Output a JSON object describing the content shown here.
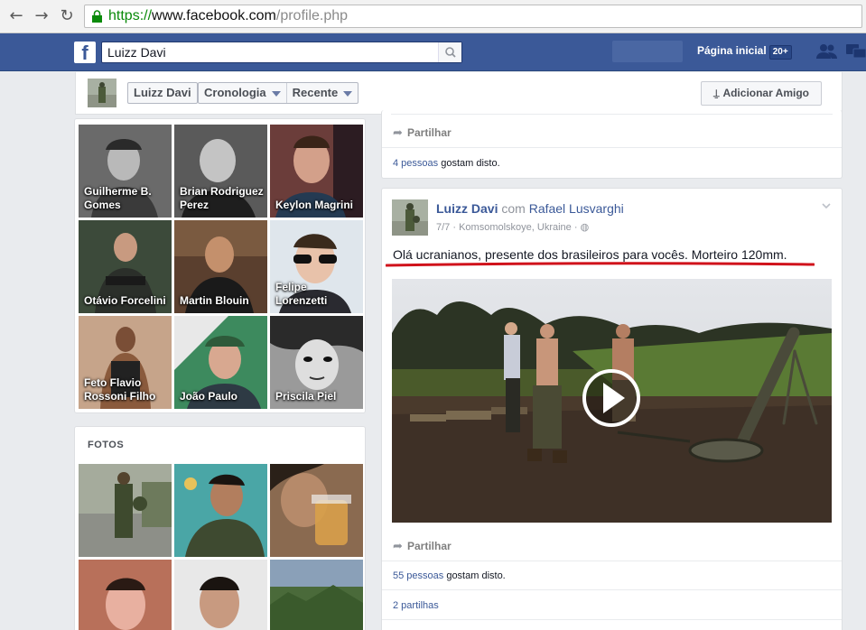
{
  "browser": {
    "url_scheme": "https://",
    "url_host": "www.facebook.com",
    "url_path": "/profile.php"
  },
  "topbar": {
    "search_value": "Luizz Davi",
    "home_label": "Página inicial",
    "home_count": "20+"
  },
  "profile_bar": {
    "name": "Luizz Davi",
    "timeline": "Cronologia",
    "recent": "Recente",
    "add_friend": "Adicionar Amigo"
  },
  "friends": [
    {
      "name": "Guilherme B. Gomes"
    },
    {
      "name": "Brian Rodriguez Perez"
    },
    {
      "name": "Keylon Magrini"
    },
    {
      "name": "Otávio Forcelini"
    },
    {
      "name": "Martin Blouin"
    },
    {
      "name": "Felipe Lorenzetti"
    },
    {
      "name": "Feto Flavio Rossoni Filho"
    },
    {
      "name": "João Paulo"
    },
    {
      "name": "Priscila Piel"
    }
  ],
  "photos": {
    "heading": "FOTOS"
  },
  "post1": {
    "share": "Partilhar",
    "likes_count": "4 pessoas",
    "likes_suffix": " gostam disto."
  },
  "post2": {
    "author": "Luizz Davi",
    "with_word": "com",
    "tagged": "Rafael Lusvarghi",
    "date": "7/7",
    "location": "Komsomolskoye, Ukraine",
    "text": "Olá ucranianos, presente dos brasileiros para vocês. Morteiro 120mm.",
    "share": "Partilhar",
    "likes_count": "55 pessoas",
    "likes_suffix": " gostam disto.",
    "shares": "2 partilhas"
  },
  "colors": {
    "fb_blue": "#3b5998",
    "highlight_red": "#d0121b"
  }
}
